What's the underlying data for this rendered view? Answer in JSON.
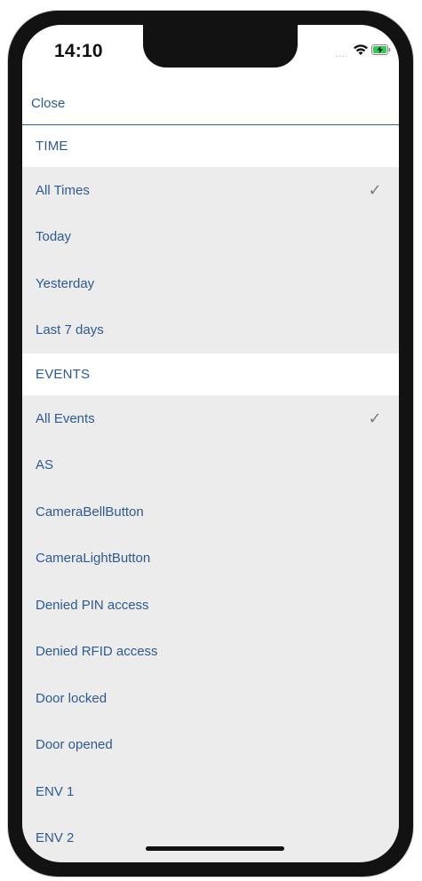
{
  "status": {
    "time": "14:10",
    "signal": ".....",
    "wifi_icon": "wifi-icon",
    "battery_icon": "battery-charging-icon"
  },
  "header": {
    "close_label": "Close"
  },
  "sections": {
    "time": {
      "title": "TIME",
      "items": [
        {
          "label": "All Times",
          "check": "✓"
        },
        {
          "label": "Today",
          "check": ""
        },
        {
          "label": "Yesterday",
          "check": ""
        },
        {
          "label": "Last 7 days",
          "check": ""
        }
      ]
    },
    "events": {
      "title": "EVENTS",
      "items": [
        {
          "label": "All Events",
          "check": "✓"
        },
        {
          "label": "AS",
          "check": ""
        },
        {
          "label": "CameraBellButton",
          "check": ""
        },
        {
          "label": "CameraLightButton",
          "check": ""
        },
        {
          "label": "Denied PIN access",
          "check": ""
        },
        {
          "label": "Denied RFID access",
          "check": ""
        },
        {
          "label": "Door locked",
          "check": ""
        },
        {
          "label": "Door opened",
          "check": ""
        },
        {
          "label": "ENV 1",
          "check": ""
        },
        {
          "label": "ENV 2",
          "check": ""
        }
      ]
    }
  },
  "colors": {
    "accent": "#2d5a93",
    "background": "#ececec",
    "section_background": "#ffffff",
    "check": "#7a7a7a"
  }
}
